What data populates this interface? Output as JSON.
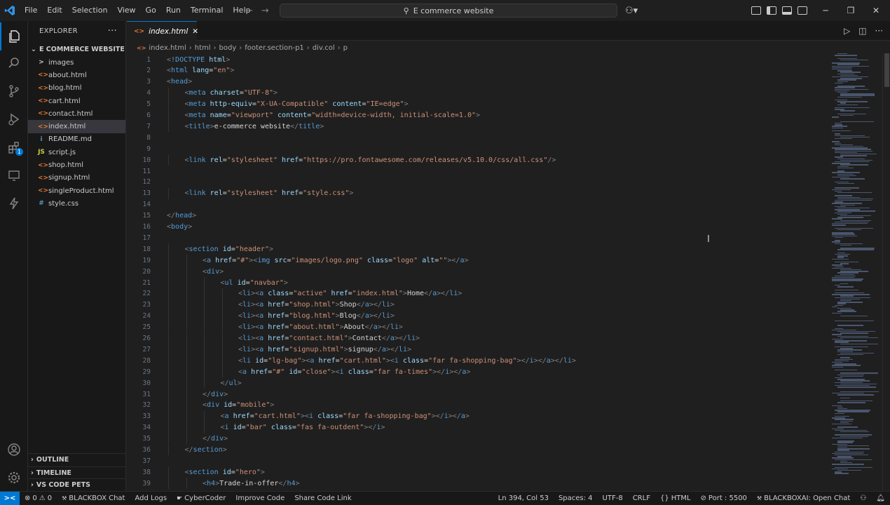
{
  "menu": [
    "File",
    "Edit",
    "Selection",
    "View",
    "Go",
    "Run",
    "Terminal",
    "Help"
  ],
  "search": {
    "text": "E commerce website"
  },
  "explorer": {
    "title": "EXPLORER",
    "folder": "E COMMERCE WEBSITE",
    "items": [
      {
        "name": "images",
        "icon": ">",
        "color": "#cccccc"
      },
      {
        "name": "about.html",
        "icon": "<>",
        "color": "#e37933"
      },
      {
        "name": "blog.html",
        "icon": "<>",
        "color": "#e37933"
      },
      {
        "name": "cart.html",
        "icon": "<>",
        "color": "#e37933"
      },
      {
        "name": "contact.html",
        "icon": "<>",
        "color": "#e37933"
      },
      {
        "name": "index.html",
        "icon": "<>",
        "color": "#e37933"
      },
      {
        "name": "README.md",
        "icon": "i",
        "color": "#519aba"
      },
      {
        "name": "script.js",
        "icon": "JS",
        "color": "#cbcb41"
      },
      {
        "name": "shop.html",
        "icon": "<>",
        "color": "#e37933"
      },
      {
        "name": "signup.html",
        "icon": "<>",
        "color": "#e37933"
      },
      {
        "name": "singleProduct.html",
        "icon": "<>",
        "color": "#e37933"
      },
      {
        "name": "style.css",
        "icon": "#",
        "color": "#519aba"
      }
    ],
    "selected_index": 5,
    "sections": [
      "OUTLINE",
      "TIMELINE",
      "VS CODE PETS"
    ]
  },
  "tab": {
    "label": "index.html"
  },
  "breadcrumb": [
    "index.html",
    "html",
    "body",
    "footer.section-p1",
    "div.col",
    "p"
  ],
  "code_lines": [
    {
      "n": "1",
      "indent": 0,
      "text": "<!DOCTYPE html>"
    },
    {
      "n": "2",
      "indent": 0,
      "text": "<html lang=\"en\">"
    },
    {
      "n": "3",
      "indent": 0,
      "text": "<head>"
    },
    {
      "n": "4",
      "indent": 1,
      "text": "<meta charset=\"UTF-8\">"
    },
    {
      "n": "5",
      "indent": 1,
      "text": "<meta http-equiv=\"X-UA-Compatible\" content=\"IE=edge\">"
    },
    {
      "n": "6",
      "indent": 1,
      "text": "<meta name=\"viewport\" content=\"width=device-width, initial-scale=1.0\">"
    },
    {
      "n": "7",
      "indent": 1,
      "text": "<title>e-commerce website</title>"
    },
    {
      "n": "8",
      "indent": 0,
      "text": ""
    },
    {
      "n": "9",
      "indent": 0,
      "text": ""
    },
    {
      "n": "10",
      "indent": 1,
      "text": "<link rel=\"stylesheet\" href=\"https://pro.fontawesome.com/releases/v5.10.0/css/all.css\"/>"
    },
    {
      "n": "11",
      "indent": 0,
      "text": ""
    },
    {
      "n": "12",
      "indent": 0,
      "text": ""
    },
    {
      "n": "13",
      "indent": 1,
      "text": "<link rel=\"stylesheet\" href=\"style.css\">"
    },
    {
      "n": "14",
      "indent": 0,
      "text": ""
    },
    {
      "n": "15",
      "indent": 0,
      "text": "</head>"
    },
    {
      "n": "16",
      "indent": 0,
      "text": "<body>"
    },
    {
      "n": "17",
      "indent": 0,
      "text": ""
    },
    {
      "n": "18",
      "indent": 1,
      "text": "<section id=\"header\">"
    },
    {
      "n": "19",
      "indent": 2,
      "text": "<a href=\"#\"><img src=\"images/logo.png\" class=\"logo\" alt=\"\"></a>"
    },
    {
      "n": "20",
      "indent": 2,
      "text": "<div>"
    },
    {
      "n": "21",
      "indent": 3,
      "text": "<ul id=\"navbar\">"
    },
    {
      "n": "22",
      "indent": 4,
      "text": "<li><a class=\"active\" href=\"index.html\">Home</a></li>"
    },
    {
      "n": "23",
      "indent": 4,
      "text": "<li><a href=\"shop.html\">Shop</a></li>"
    },
    {
      "n": "24",
      "indent": 4,
      "text": "<li><a href=\"blog.html\">Blog</a></li>"
    },
    {
      "n": "25",
      "indent": 4,
      "text": "<li><a href=\"about.html\">About</a></li>"
    },
    {
      "n": "26",
      "indent": 4,
      "text": "<li><a href=\"contact.html\">Contact</a></li>"
    },
    {
      "n": "27",
      "indent": 4,
      "text": "<li><a href=\"signup.html\">signup</a></li>"
    },
    {
      "n": "28",
      "indent": 4,
      "text": "<li id=\"lg-bag\"><a href=\"cart.html\"><i class=\"far fa-shopping-bag\"></i></a></li>"
    },
    {
      "n": "29",
      "indent": 4,
      "text": "<a href=\"#\" id=\"close\"><i class=\"far fa-times\"></i></a>"
    },
    {
      "n": "30",
      "indent": 3,
      "text": "</ul>"
    },
    {
      "n": "31",
      "indent": 2,
      "text": "</div>"
    },
    {
      "n": "32",
      "indent": 2,
      "text": "<div id=\"mobile\">"
    },
    {
      "n": "33",
      "indent": 3,
      "text": "<a href=\"cart.html\"><i class=\"far fa-shopping-bag\"></i></a>"
    },
    {
      "n": "34",
      "indent": 3,
      "text": "<i id=\"bar\" class=\"fas fa-outdent\"></i>"
    },
    {
      "n": "35",
      "indent": 2,
      "text": "</div>"
    },
    {
      "n": "36",
      "indent": 1,
      "text": "</section>"
    },
    {
      "n": "37",
      "indent": 0,
      "text": ""
    },
    {
      "n": "38",
      "indent": 1,
      "text": "<section id=\"hero\">"
    },
    {
      "n": "39",
      "indent": 2,
      "text": "<h4>Trade-in-offer</h4>"
    }
  ],
  "statusbar": {
    "errors": "0",
    "warnings": "0",
    "blackbox_chat": "BLACKBOX Chat",
    "add_logs": "Add Logs",
    "cybercoder": "CyberCoder",
    "improve_code": "Improve Code",
    "share_code_link": "Share Code Link",
    "position": "Ln 394, Col 53",
    "spaces": "Spaces: 4",
    "encoding": "UTF-8",
    "eol": "CRLF",
    "language": "HTML",
    "port": "Port : 5500",
    "blackboxai": "BLACKBOXAI: Open Chat"
  },
  "colors": {
    "accent": "#0078d4",
    "editor_bg": "#1f1f1f",
    "sidebar_bg": "#181818"
  }
}
